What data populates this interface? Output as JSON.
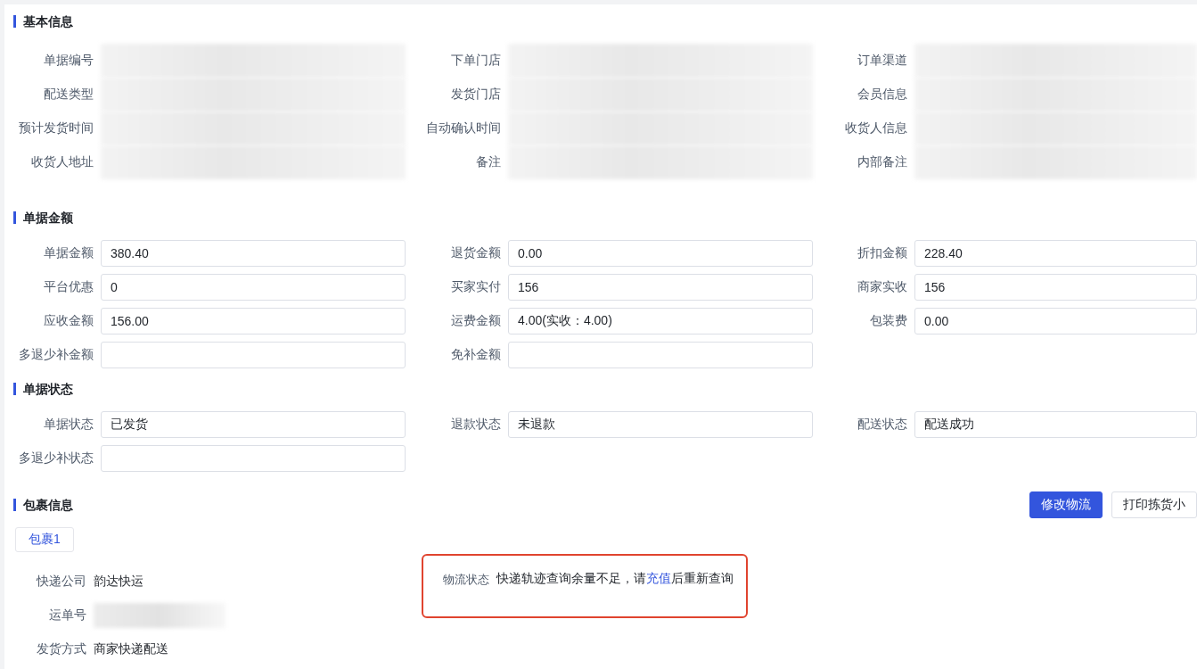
{
  "sections": [
    {
      "title": "基本信息",
      "fields": [
        {
          "label": "单据编号",
          "kind": "blurred"
        },
        {
          "label": "下单门店",
          "kind": "blurred"
        },
        {
          "label": "订单渠道",
          "kind": "blurred"
        },
        {
          "label": "配送类型",
          "kind": "blurred"
        },
        {
          "label": "发货门店",
          "kind": "blurred"
        },
        {
          "label": "会员信息",
          "kind": "blurred"
        },
        {
          "label": "预计发货时间",
          "kind": "blurred"
        },
        {
          "label": "自动确认时间",
          "kind": "blurred"
        },
        {
          "label": "收货人信息",
          "kind": "blurred"
        },
        {
          "label": "收货人地址",
          "kind": "blurred"
        },
        {
          "label": "备注",
          "kind": "blurred"
        },
        {
          "label": "内部备注",
          "kind": "blurred"
        }
      ]
    },
    {
      "title": "单据金额",
      "fields": [
        {
          "label": "单据金额",
          "kind": "input",
          "value": "380.40"
        },
        {
          "label": "退货金额",
          "kind": "input",
          "value": "0.00"
        },
        {
          "label": "折扣金额",
          "kind": "input",
          "value": "228.40"
        },
        {
          "label": "平台优惠",
          "kind": "input",
          "value": "0"
        },
        {
          "label": "买家实付",
          "kind": "input",
          "value": "156"
        },
        {
          "label": "商家实收",
          "kind": "input",
          "value": "156"
        },
        {
          "label": "应收金额",
          "kind": "input",
          "value": "156.00"
        },
        {
          "label": "运费金额",
          "kind": "input",
          "value": "4.00(实收：4.00)"
        },
        {
          "label": "包装费",
          "kind": "input",
          "value": "0.00"
        },
        {
          "label": "多退少补金额",
          "kind": "input"
        },
        {
          "label": "免补金额",
          "kind": "input"
        }
      ]
    },
    {
      "title": "单据状态",
      "fields": [
        {
          "label": "单据状态",
          "kind": "input",
          "value": "已发货"
        },
        {
          "label": "退款状态",
          "kind": "input",
          "value": "未退款"
        },
        {
          "label": "配送状态",
          "kind": "input",
          "value": "配送成功"
        },
        {
          "label": "多退少补状态",
          "kind": "input"
        }
      ]
    }
  ],
  "package": {
    "title": "包裹信息",
    "buttons": [
      {
        "label": "修改物流",
        "primary": true
      },
      {
        "label": "打印拣货小",
        "primary": false
      }
    ],
    "tabs": [
      {
        "label": "包裹1",
        "selected": true
      }
    ],
    "details": [
      {
        "label": "快递公司",
        "kind": "text",
        "value": "韵达快运"
      },
      {
        "label": "运单号",
        "kind": "blurred"
      },
      {
        "label": "发货方式",
        "kind": "text",
        "value": "商家快递配送"
      }
    ],
    "logistics": {
      "label": "物流状态",
      "before": "快递轨迹查询余量不足，请",
      "link": "充值",
      "after": "后重新查询"
    }
  }
}
